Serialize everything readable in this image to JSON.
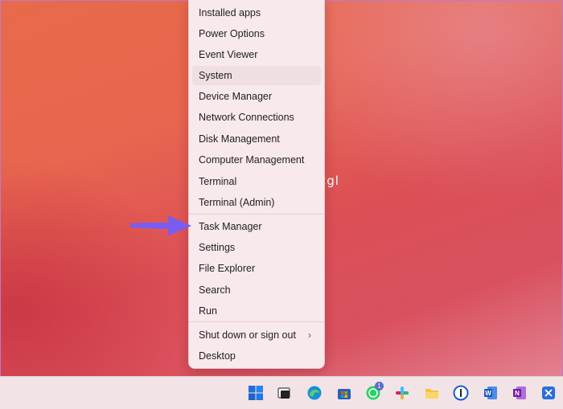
{
  "menu": {
    "items": [
      {
        "label": "Installed apps"
      },
      {
        "label": "Power Options"
      },
      {
        "label": "Event Viewer"
      },
      {
        "label": "System"
      },
      {
        "label": "Device Manager"
      },
      {
        "label": "Network Connections"
      },
      {
        "label": "Disk Management"
      },
      {
        "label": "Computer Management"
      },
      {
        "label": "Terminal"
      },
      {
        "label": "Terminal (Admin)"
      },
      {
        "label": "Task Manager"
      },
      {
        "label": "Settings"
      },
      {
        "label": "File Explorer"
      },
      {
        "label": "Search"
      },
      {
        "label": "Run"
      },
      {
        "label": "Shut down or sign out",
        "submenu": "›"
      },
      {
        "label": "Desktop"
      }
    ],
    "highlighted": "System"
  },
  "watermark": "cgl",
  "taskbar": {
    "icons": [
      "windows-start-icon",
      "task-view-icon",
      "edge-icon",
      "store-icon",
      "whatsapp-icon",
      "slack-icon",
      "file-explorer-icon",
      "onepassword-icon",
      "word-icon",
      "onenote-icon",
      "snipping-tool-icon"
    ],
    "whatsapp_badge": "1"
  },
  "colors": {
    "menu_bg": "#f7e9ec",
    "arrow": "#7a5cf0",
    "taskbar_bg": "#f2e3e7"
  }
}
